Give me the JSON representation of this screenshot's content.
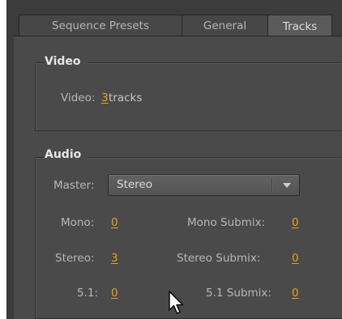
{
  "tabs": [
    {
      "label": "Sequence Presets"
    },
    {
      "label": "General"
    },
    {
      "label": "Tracks"
    }
  ],
  "video": {
    "title": "Video",
    "label": "Video:",
    "count": "3",
    "unit": "tracks"
  },
  "audio": {
    "title": "Audio",
    "master_label": "Master:",
    "master_value": "Stereo",
    "mono_label": "Mono:",
    "mono_value": "0",
    "stereo_label": "Stereo:",
    "stereo_value": "3",
    "fiveone_label": "5.1:",
    "fiveone_value": "0",
    "mono_submix_label": "Mono Submix:",
    "mono_submix_value": "0",
    "stereo_submix_label": "Stereo Submix:",
    "stereo_submix_value": "0",
    "fiveone_submix_label": "5.1 Submix:",
    "fiveone_submix_value": "0"
  },
  "colors": {
    "accent": "#e8a21a",
    "panel": "#4a4a4a",
    "label": "#b7b7b7"
  }
}
